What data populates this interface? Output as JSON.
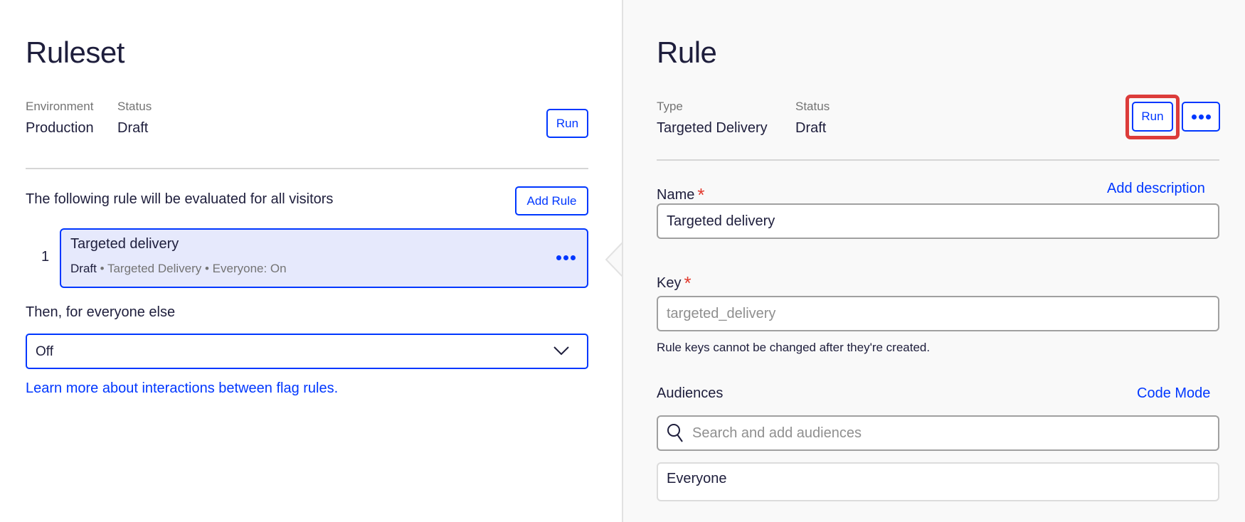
{
  "ruleset": {
    "title": "Ruleset",
    "environment_label": "Environment",
    "environment_value": "Production",
    "status_label": "Status",
    "status_value": "Draft",
    "run_label": "Run",
    "evaluated_text": "The following rule will be evaluated for all visitors",
    "add_rule_label": "Add Rule",
    "rules": [
      {
        "index": "1",
        "name": "Targeted delivery",
        "status": "Draft",
        "type": "Targeted Delivery",
        "audience": "Everyone: On",
        "separator": "•"
      }
    ],
    "everyone_else_label": "Then, for everyone else",
    "everyone_else_value": "Off",
    "learn_more_link": "Learn more about interactions between flag rules."
  },
  "rule": {
    "title": "Rule",
    "type_label": "Type",
    "type_value": "Targeted Delivery",
    "status_label": "Status",
    "status_value": "Draft",
    "run_label": "Run",
    "name_label": "Name",
    "required_mark": "*",
    "add_description_link": "Add description",
    "name_value": "Targeted delivery",
    "key_label": "Key",
    "key_value": "targeted_delivery",
    "key_help": "Rule keys cannot be changed after they're created.",
    "audiences_label": "Audiences",
    "code_mode_link": "Code Mode",
    "audience_search_placeholder": "Search and add audiences",
    "audience_selected": "Everyone"
  },
  "colors": {
    "accent": "#0037ff",
    "highlight": "#dc3c3a",
    "required": "#e23a2e",
    "selected_rule_bg": "#e6e9fc"
  }
}
